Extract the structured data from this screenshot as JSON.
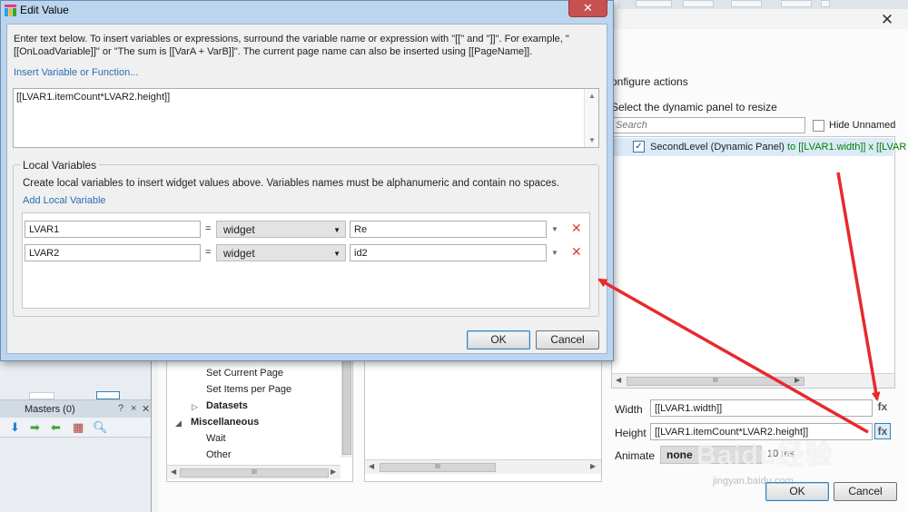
{
  "colors": {
    "accent_blue": "#2b6cb5",
    "arrow_red": "#e8292d",
    "selection": "#dceaf8",
    "close_red": "#c75050",
    "delete_red": "#e03a3a"
  },
  "dialog": {
    "title": "Edit Value",
    "description": "Enter text below. To insert variables or expressions, surround the variable name or expression with \"[[\" and \"]]\". For example, \"[[OnLoadVariable]]\" or \"The sum is [[VarA + VarB]]\". The current page name can also be inserted using [[PageName]].",
    "insert_link": "Insert Variable or Function...",
    "expression": "[[LVAR1.itemCount*LVAR2.height]]",
    "close_icon": "close-icon",
    "local_variables": {
      "title": "Local Variables",
      "description": "Create local variables to insert widget values above. Variables names must be alphanumeric and contain no spaces.",
      "add_link": "Add Local Variable",
      "rows": [
        {
          "name": "LVAR1",
          "equals": "=",
          "type": "widget",
          "target": "Re"
        },
        {
          "name": "LVAR2",
          "equals": "=",
          "type": "widget",
          "target": "id2"
        }
      ]
    },
    "ok_label": "OK",
    "cancel_label": "Cancel"
  },
  "case_editor": {
    "section_title": "onfigure actions",
    "configure_label": "Select the dynamic panel to resize",
    "search_placeholder": "Search",
    "hide_unnamed_label": "Hide Unnamed",
    "panel_row": {
      "checked": "✓",
      "name": "SecondLevel (Dynamic Panel)",
      "detail": "to [[LVAR1.width]] x [[LVAR"
    },
    "width_label": "Width",
    "width_value": "[[LVAR1.width]]",
    "height_label": "Height",
    "height_value": "[[LVAR1.itemCount*LVAR2.height]]",
    "fx_label": "fx",
    "animate_label": "Animate",
    "animate_value": "none",
    "animate_extra": "10 ms",
    "ok_label": "OK",
    "cancel_label": "Cancel",
    "close_glyph": "✕",
    "tree": [
      {
        "label": "Set Current Page",
        "bold": false,
        "indent": 1
      },
      {
        "label": "Set Items per Page",
        "bold": false,
        "indent": 1
      },
      {
        "label": "Datasets",
        "bold": true,
        "indent": 1,
        "arrow": "▷"
      },
      {
        "label": "Miscellaneous",
        "bold": true,
        "indent": 0,
        "arrow": "◢"
      },
      {
        "label": "Wait",
        "bold": false,
        "indent": 1
      },
      {
        "label": "Other",
        "bold": false,
        "indent": 1
      }
    ]
  },
  "masters": {
    "title": "Masters (0)",
    "help": "?",
    "pin": "×",
    "close": "✕"
  },
  "watermark": {
    "main": "Baidu经验",
    "sub": "jingyan.baidu.com"
  }
}
